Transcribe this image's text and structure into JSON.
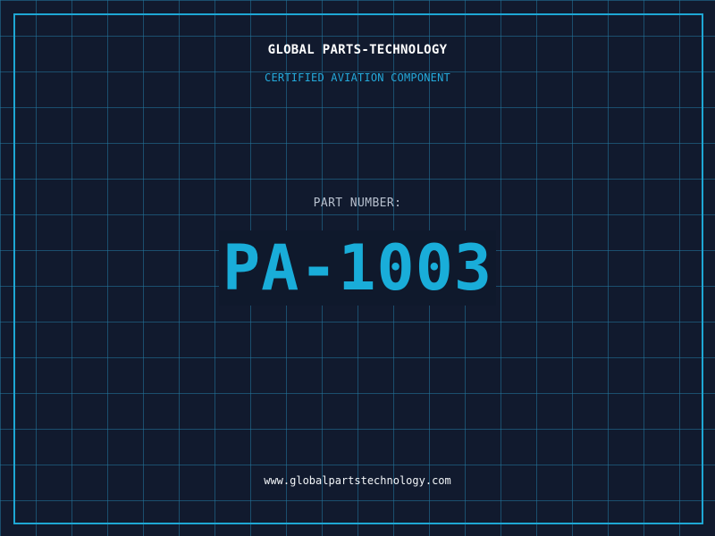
{
  "header": {
    "company": "GLOBAL PARTS-TECHNOLOGY",
    "certification": "CERTIFIED AVIATION COMPONENT"
  },
  "part": {
    "label": "PART NUMBER:",
    "number": "PA-1003"
  },
  "footer": {
    "website": "www.globalpartstechnology.com"
  },
  "colors": {
    "background": "#111a2e",
    "grid": "#2378a0",
    "accent": "#1ea7d4",
    "text_primary": "#ffffff",
    "text_label": "#b7c0ce"
  }
}
